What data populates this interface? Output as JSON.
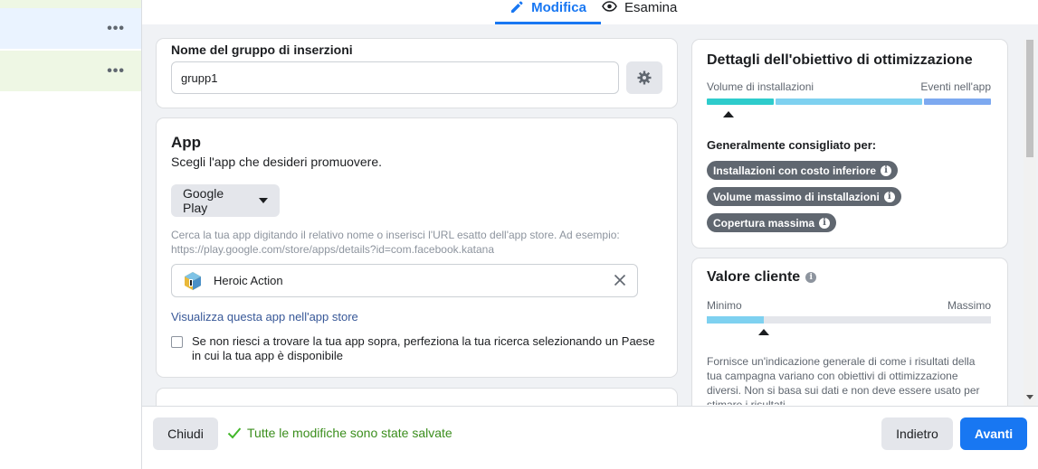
{
  "tabs": {
    "edit": "Modifica",
    "review": "Esamina"
  },
  "sidebar": {
    "rows": [
      {
        "menu": "•••"
      },
      {
        "menu": "•••"
      }
    ]
  },
  "name_section": {
    "label": "Nome del gruppo di inserzioni",
    "value": "grupp1"
  },
  "app_section": {
    "title": "App",
    "subtitle": "Scegli l'app che desideri promuovere.",
    "store": "Google Play",
    "help": "Cerca la tua app digitando il relativo nome o inserisci l'URL esatto dell'app store. Ad esempio: https://play.google.com/store/apps/details?id=com.facebook.katana",
    "selected_app": "Heroic Action",
    "store_link": "Visualizza questa app nell'app store",
    "checkbox_label": "Se non riesci a trovare la tua app sopra, perfeziona la tua ricerca selezionando un Paese in cui la tua app è disponibile"
  },
  "objective": {
    "title": "Dettagli dell'obiettivo di ottimizzazione",
    "left_label": "Volume di installazioni",
    "right_label": "Eventi nell'app",
    "recommended_label": "Generalmente consigliato per:",
    "pills": [
      "Installazioni con costo inferiore",
      "Volume massimo di installazioni",
      "Copertura massima"
    ],
    "colors": {
      "seg1": "#2ecccc",
      "seg2": "#7ed1f0",
      "seg3": "#7da9f0"
    }
  },
  "customer_value": {
    "title": "Valore cliente",
    "min_label": "Minimo",
    "max_label": "Massimo",
    "level": 0.2,
    "description": "Fornisce un'indicazione generale di come i risultati della tua campagna variano con obiettivi di ottimizzazione diversi. Non si basa sui dati e non deve essere usato per stimare i risultati."
  },
  "footer": {
    "close": "Chiudi",
    "saved": "Tutte le modifiche sono state salvate",
    "back": "Indietro",
    "next": "Avanti"
  },
  "accent": "#1877f2",
  "icons": [
    "pencil-icon",
    "eye-icon",
    "gear-icon",
    "app-icon",
    "close-icon",
    "check-icon",
    "info-icon",
    "more-icon"
  ]
}
